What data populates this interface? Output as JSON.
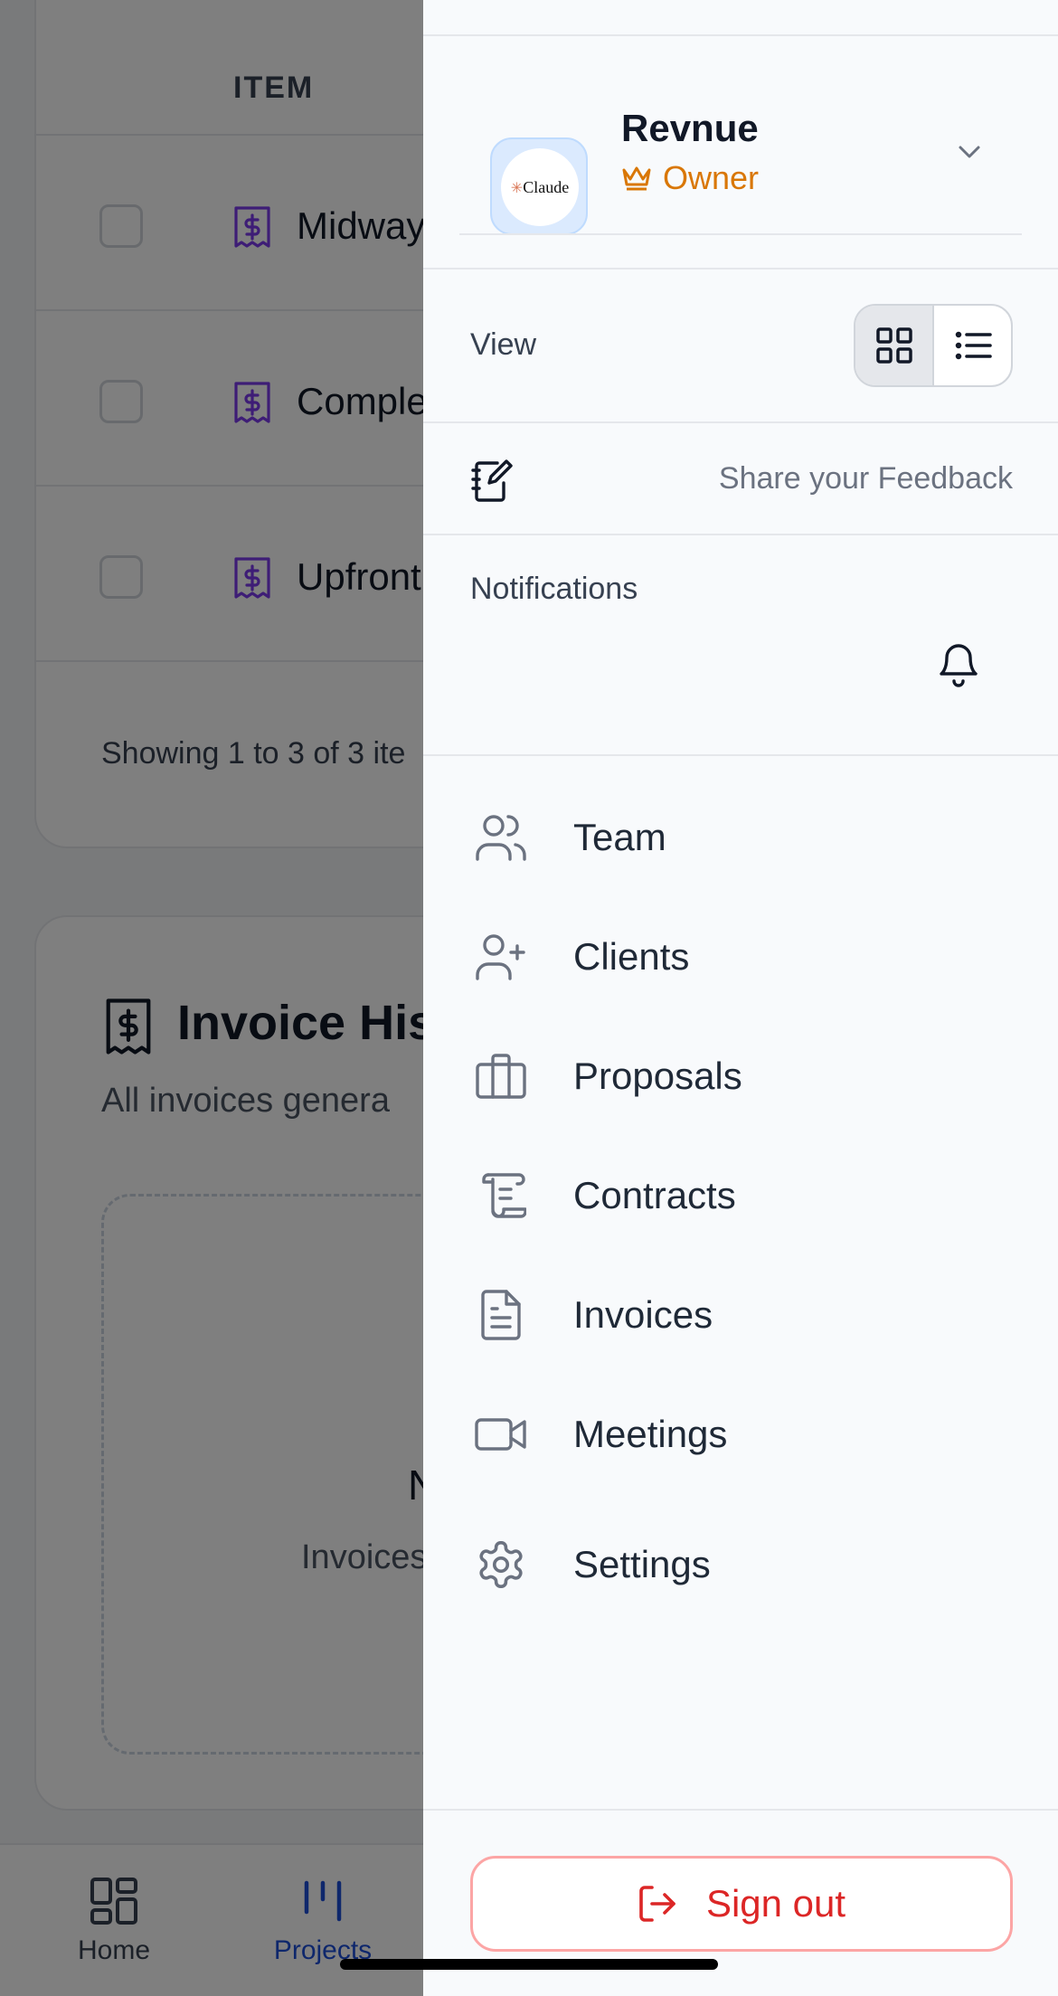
{
  "background": {
    "table": {
      "column_header": "ITEM",
      "rows": [
        {
          "label": "Midway"
        },
        {
          "label": "Comple"
        },
        {
          "label": "Upfront"
        }
      ],
      "showing_text": "Showing 1 to 3 of 3 ite"
    },
    "invoice_history": {
      "title": "Invoice His",
      "subtitle": "All invoices genera",
      "empty_title": "No",
      "empty_subtitle": "Invoices w"
    },
    "bottom_nav": {
      "tabs": [
        {
          "label": "Home",
          "icon": "grid-icon",
          "active": false
        },
        {
          "label": "Projects",
          "icon": "projects-icon",
          "active": true
        }
      ]
    }
  },
  "drawer": {
    "workspace": {
      "logo_text": "Claude",
      "name": "Revnue",
      "role": "Owner",
      "role_icon": "crown-icon",
      "role_color": "#d97706"
    },
    "view": {
      "label": "View",
      "modes": [
        "grid",
        "list"
      ],
      "selected": "grid"
    },
    "feedback": {
      "label": "Share your Feedback",
      "icon": "notebook-pen-icon"
    },
    "notifications": {
      "label": "Notifications",
      "icon": "bell-icon"
    },
    "menu": [
      {
        "label": "Team",
        "icon": "users-icon"
      },
      {
        "label": "Clients",
        "icon": "user-plus-icon"
      },
      {
        "label": "Proposals",
        "icon": "briefcase-icon"
      },
      {
        "label": "Contracts",
        "icon": "scroll-icon"
      },
      {
        "label": "Invoices",
        "icon": "file-text-icon"
      },
      {
        "label": "Meetings",
        "icon": "video-icon"
      },
      {
        "label": "Settings",
        "icon": "gear-icon"
      }
    ],
    "sign_out": {
      "label": "Sign out",
      "icon": "log-out-icon",
      "color": "#dc2626"
    }
  },
  "colors": {
    "accent_purple": "#7c3aed",
    "accent_blue": "#1d4ed8",
    "drawer_bg": "#f8fafc"
  }
}
